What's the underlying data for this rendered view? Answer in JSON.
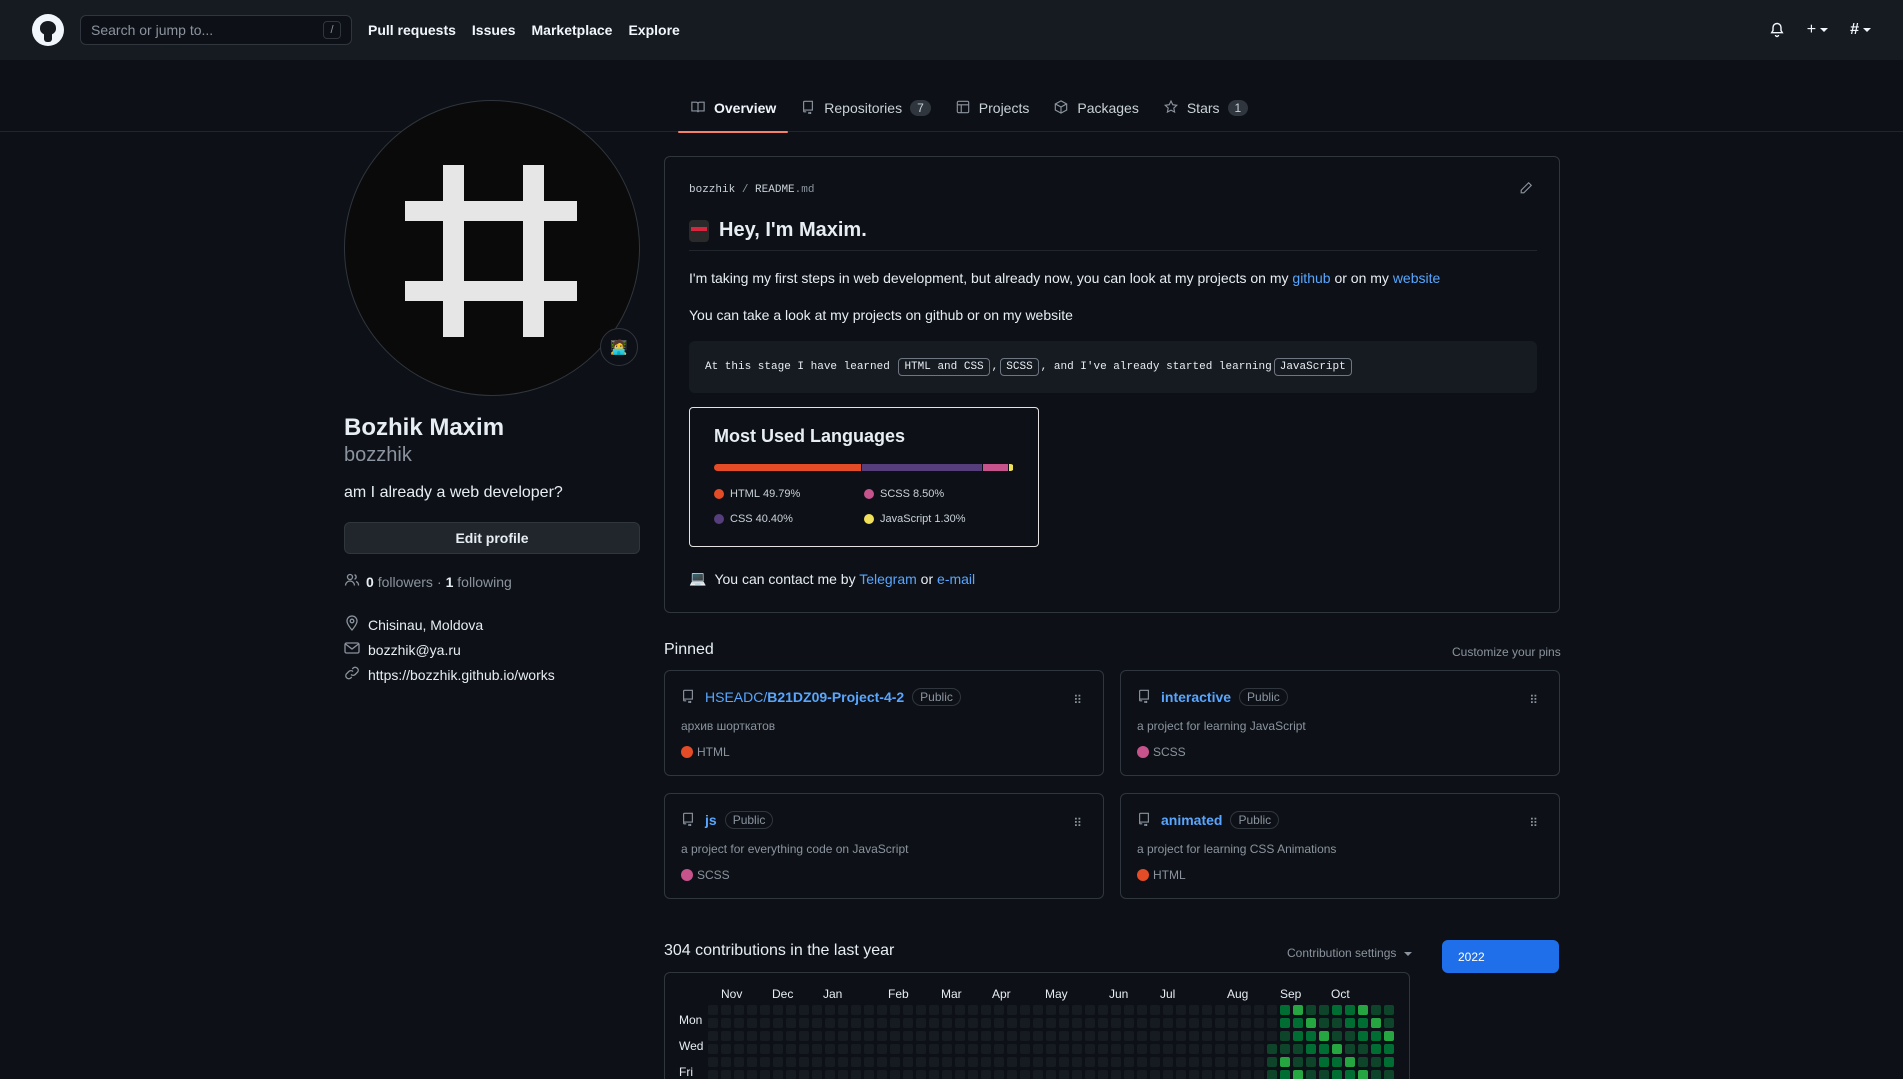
{
  "header": {
    "search_placeholder": "Search or jump to...",
    "search_key": "/",
    "nav": [
      "Pull requests",
      "Issues",
      "Marketplace",
      "Explore"
    ]
  },
  "tabs": [
    {
      "label": "Overview",
      "icon": "book-icon",
      "active": true
    },
    {
      "label": "Repositories",
      "icon": "repo-icon",
      "count": "7"
    },
    {
      "label": "Projects",
      "icon": "table-icon"
    },
    {
      "label": "Packages",
      "icon": "package-icon"
    },
    {
      "label": "Stars",
      "icon": "star-icon",
      "count": "1"
    }
  ],
  "profile": {
    "name": "Bozhik Maxim",
    "login": "bozzhik",
    "bio": "am I already a web developer?",
    "edit_label": "Edit profile",
    "followers_count": "0",
    "followers_label": "followers",
    "sep": "·",
    "following_count": "1",
    "following_label": "following",
    "location": "Chisinau, Moldova",
    "email": "bozzhik@ya.ru",
    "website": "https://bozzhik.github.io/works"
  },
  "readme": {
    "owner": "bozzhik",
    "slash": "/",
    "file": "README",
    "ext": ".md",
    "heading": "Hey, I'm Maxim.",
    "p1_prefix": "I'm taking my first steps in web development, but already now, you can look at my projects on my ",
    "p1_link1": "github",
    "p1_mid": " or on my ",
    "p1_link2": "website",
    "p2": "You can take a look at my projects on github or on my website",
    "code_prefix": "At this stage I have learned ",
    "code_tok1": "HTML and CSS",
    "code_sep1": ",",
    "code_tok2": "SCSS",
    "code_sep2": ", and I've already started learning",
    "code_tok3": "JavaScript",
    "contact_prefix": "You can contact me by ",
    "contact_link1": "Telegram",
    "contact_mid": " or ",
    "contact_link2": "e-mail"
  },
  "languages_card": {
    "title": "Most Used Languages",
    "items": [
      {
        "name": "HTML",
        "percent": "49.79%",
        "value": 49.79,
        "color": "#e34c26"
      },
      {
        "name": "CSS",
        "percent": "40.40%",
        "value": 40.4,
        "color": "#563d7c"
      },
      {
        "name": "SCSS",
        "percent": "8.50%",
        "value": 8.5,
        "color": "#c6538c"
      },
      {
        "name": "JavaScript",
        "percent": "1.30%",
        "value": 1.3,
        "color": "#f1e05a"
      }
    ]
  },
  "pinned": {
    "title": "Pinned",
    "customize": "Customize your pins",
    "repos": [
      {
        "owner": "HSEADC/",
        "name": "B21DZ09-Project-4-2",
        "badge": "Public",
        "desc": "архив шорткатов",
        "lang": "HTML",
        "color": "#e34c26"
      },
      {
        "owner": "",
        "name": "interactive",
        "badge": "Public",
        "desc": "a project for learning JavaScript",
        "lang": "SCSS",
        "color": "#c6538c"
      },
      {
        "owner": "",
        "name": "js",
        "badge": "Public",
        "desc": "a project for everything code on JavaScript",
        "lang": "SCSS",
        "color": "#c6538c"
      },
      {
        "owner": "",
        "name": "animated",
        "badge": "Public",
        "desc": "a project for learning CSS Animations",
        "lang": "HTML",
        "color": "#e34c26"
      }
    ]
  },
  "contributions": {
    "title": "304 contributions in the last year",
    "settings": "Contribution settings",
    "year": "2022",
    "months": [
      "Nov",
      "Dec",
      "Jan",
      "Feb",
      "Mar",
      "Apr",
      "May",
      "Jun",
      "Jul",
      "Aug",
      "Sep",
      "Oct"
    ],
    "days": [
      "Mon",
      "Wed",
      "Fri"
    ],
    "colors": {
      "empty": "#161b22",
      "l1": "#0e4429",
      "l2": "#006d32",
      "l3": "#26a641"
    }
  }
}
